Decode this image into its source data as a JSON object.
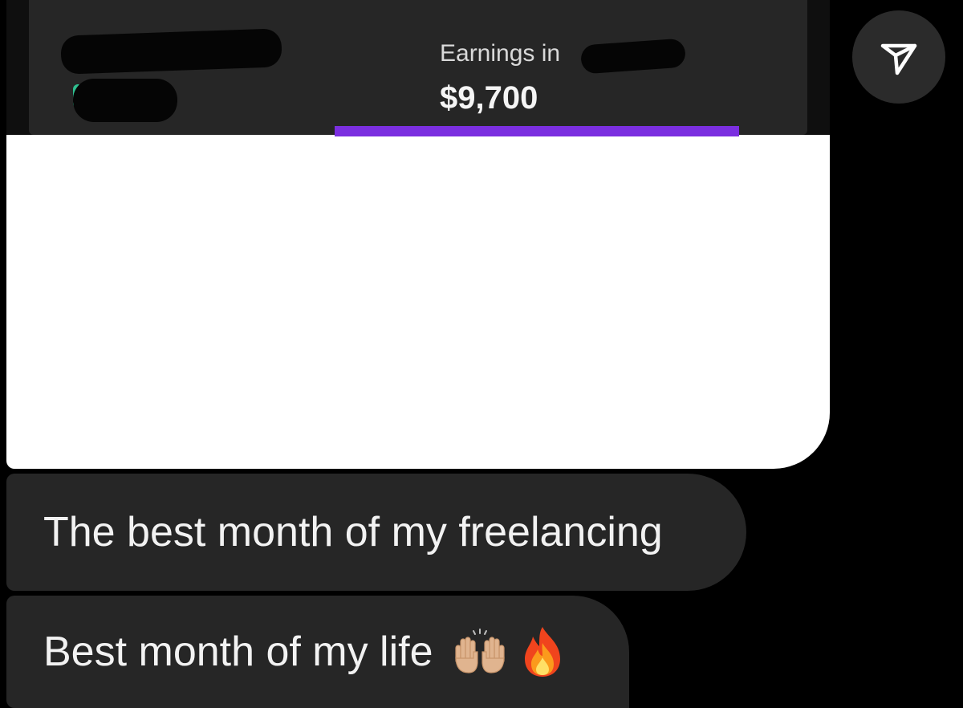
{
  "shared_post": {
    "earnings_label": "Earnings in",
    "earnings_amount": "$9,700",
    "accent_color": "#7b2fe0"
  },
  "actions": {
    "share_icon": "send-icon"
  },
  "messages": [
    {
      "text": "The best month of my freelancing"
    },
    {
      "text": "Best month of my life",
      "emojis": [
        "raising-hands-emoji",
        "fire-emoji"
      ]
    }
  ]
}
